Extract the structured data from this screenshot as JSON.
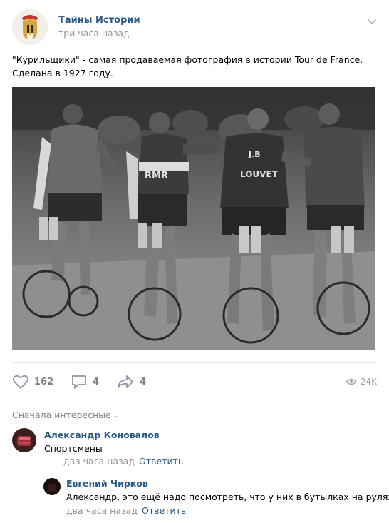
{
  "post": {
    "author": "Тайны Истории",
    "time": "три часа назад",
    "text": "\"Курильщики\" - самая продаваемая фотография в истории Tour de France. Сделана в 1927 году."
  },
  "photo": {
    "jersey_left": "RMR",
    "jersey_right_top": "J.B",
    "jersey_right_bottom": "LOUVET"
  },
  "actions": {
    "likes": "162",
    "comments": "4",
    "shares": "4",
    "views": "24K"
  },
  "comments": {
    "sort_label": "Сначала интересные",
    "items": [
      {
        "author": "Александр Коновалов",
        "text": "Спортсмены",
        "time": "два часа назад",
        "reply": "Ответить"
      },
      {
        "author": "Евгений Чирков",
        "text": "Александр, это ещё надо посмотреть, что у них в бутылках на рулях.",
        "time": "два часа назад",
        "reply": "Ответить"
      }
    ]
  },
  "colors": {
    "link": "#2a5885",
    "muted": "#939393",
    "divider": "#e7e8ec"
  }
}
